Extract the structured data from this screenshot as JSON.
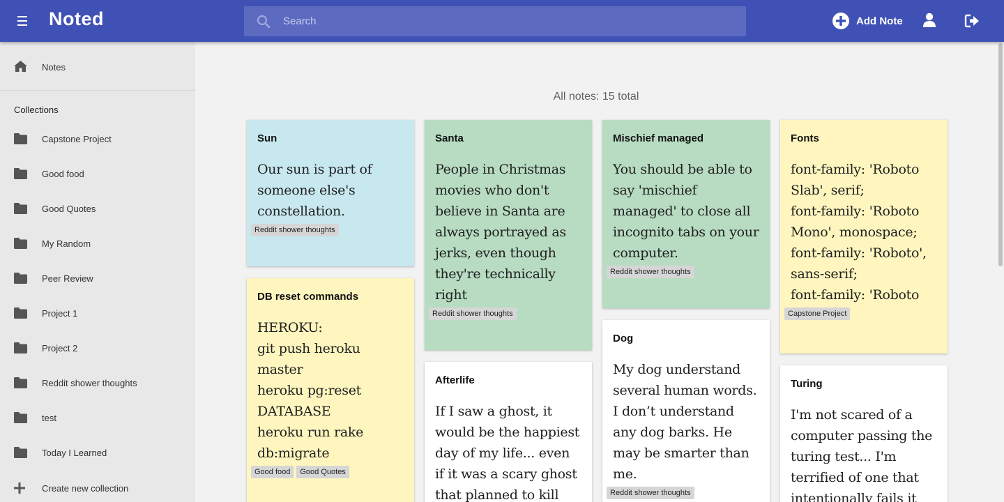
{
  "header": {
    "title": "Noted",
    "search_placeholder": "Search",
    "add_note_label": "Add Note",
    "color": "#3f51b5"
  },
  "sidebar": {
    "notes_label": "Notes",
    "collections_title": "Collections",
    "collections": [
      "Capstone Project",
      "Good food",
      "Good Quotes",
      "My Random",
      "Peer Review",
      "Project 1",
      "Project 2",
      "Reddit shower thoughts",
      "test",
      "Today I Learned"
    ],
    "create_label": "Create new collection"
  },
  "main": {
    "count_label": "All notes: 15 total",
    "notes": [
      {
        "title": "Sun",
        "body": "Our sun is part of someone else's constellation.",
        "tags": [
          "Reddit shower thoughts"
        ],
        "color": "#c8e8f0"
      },
      {
        "title": "DB reset commands",
        "body": "HEROKU:\ngit push heroku master\nheroku pg:reset DATABASE\nheroku run rake db:migrate",
        "tags": [
          "Good food",
          "Good Quotes"
        ],
        "color": "#fff6bf"
      },
      {
        "title": "Santa",
        "body": "People in Christmas movies who don't believe in Santa are always portrayed as jerks, even though they're technically right",
        "tags": [
          "Reddit shower thoughts"
        ],
        "color": "#b8dcc2"
      },
      {
        "title": "Afterlife",
        "body": "If I saw a ghost, it would be the happiest day of my life... even if it was a scary ghost that planned to kill",
        "tags": [],
        "color": "#ffffff"
      },
      {
        "title": "Mischief managed",
        "body": "You should be able to say 'mischief managed' to close all incognito tabs on your computer.",
        "tags": [
          "Reddit shower thoughts"
        ],
        "color": "#b8dcc2"
      },
      {
        "title": "Dog",
        "body": "My dog understand several human words. I don’t understand any dog barks. He may be smarter than me.",
        "tags": [
          "Reddit shower thoughts"
        ],
        "color": "#ffffff"
      },
      {
        "title": "Fonts",
        "body": "font-family: 'Roboto Slab', serif;\nfont-family: 'Roboto Mono', monospace;\nfont-family: 'Roboto', sans-serif;\nfont-family: 'Roboto",
        "tags": [
          "Capstone Project"
        ],
        "color": "#fff6bf"
      },
      {
        "title": "Turing",
        "body": "I'm not scared of a computer passing the turing test... I'm terrified of one that intentionally fails it",
        "tags": [],
        "color": "#ffffff"
      }
    ]
  }
}
